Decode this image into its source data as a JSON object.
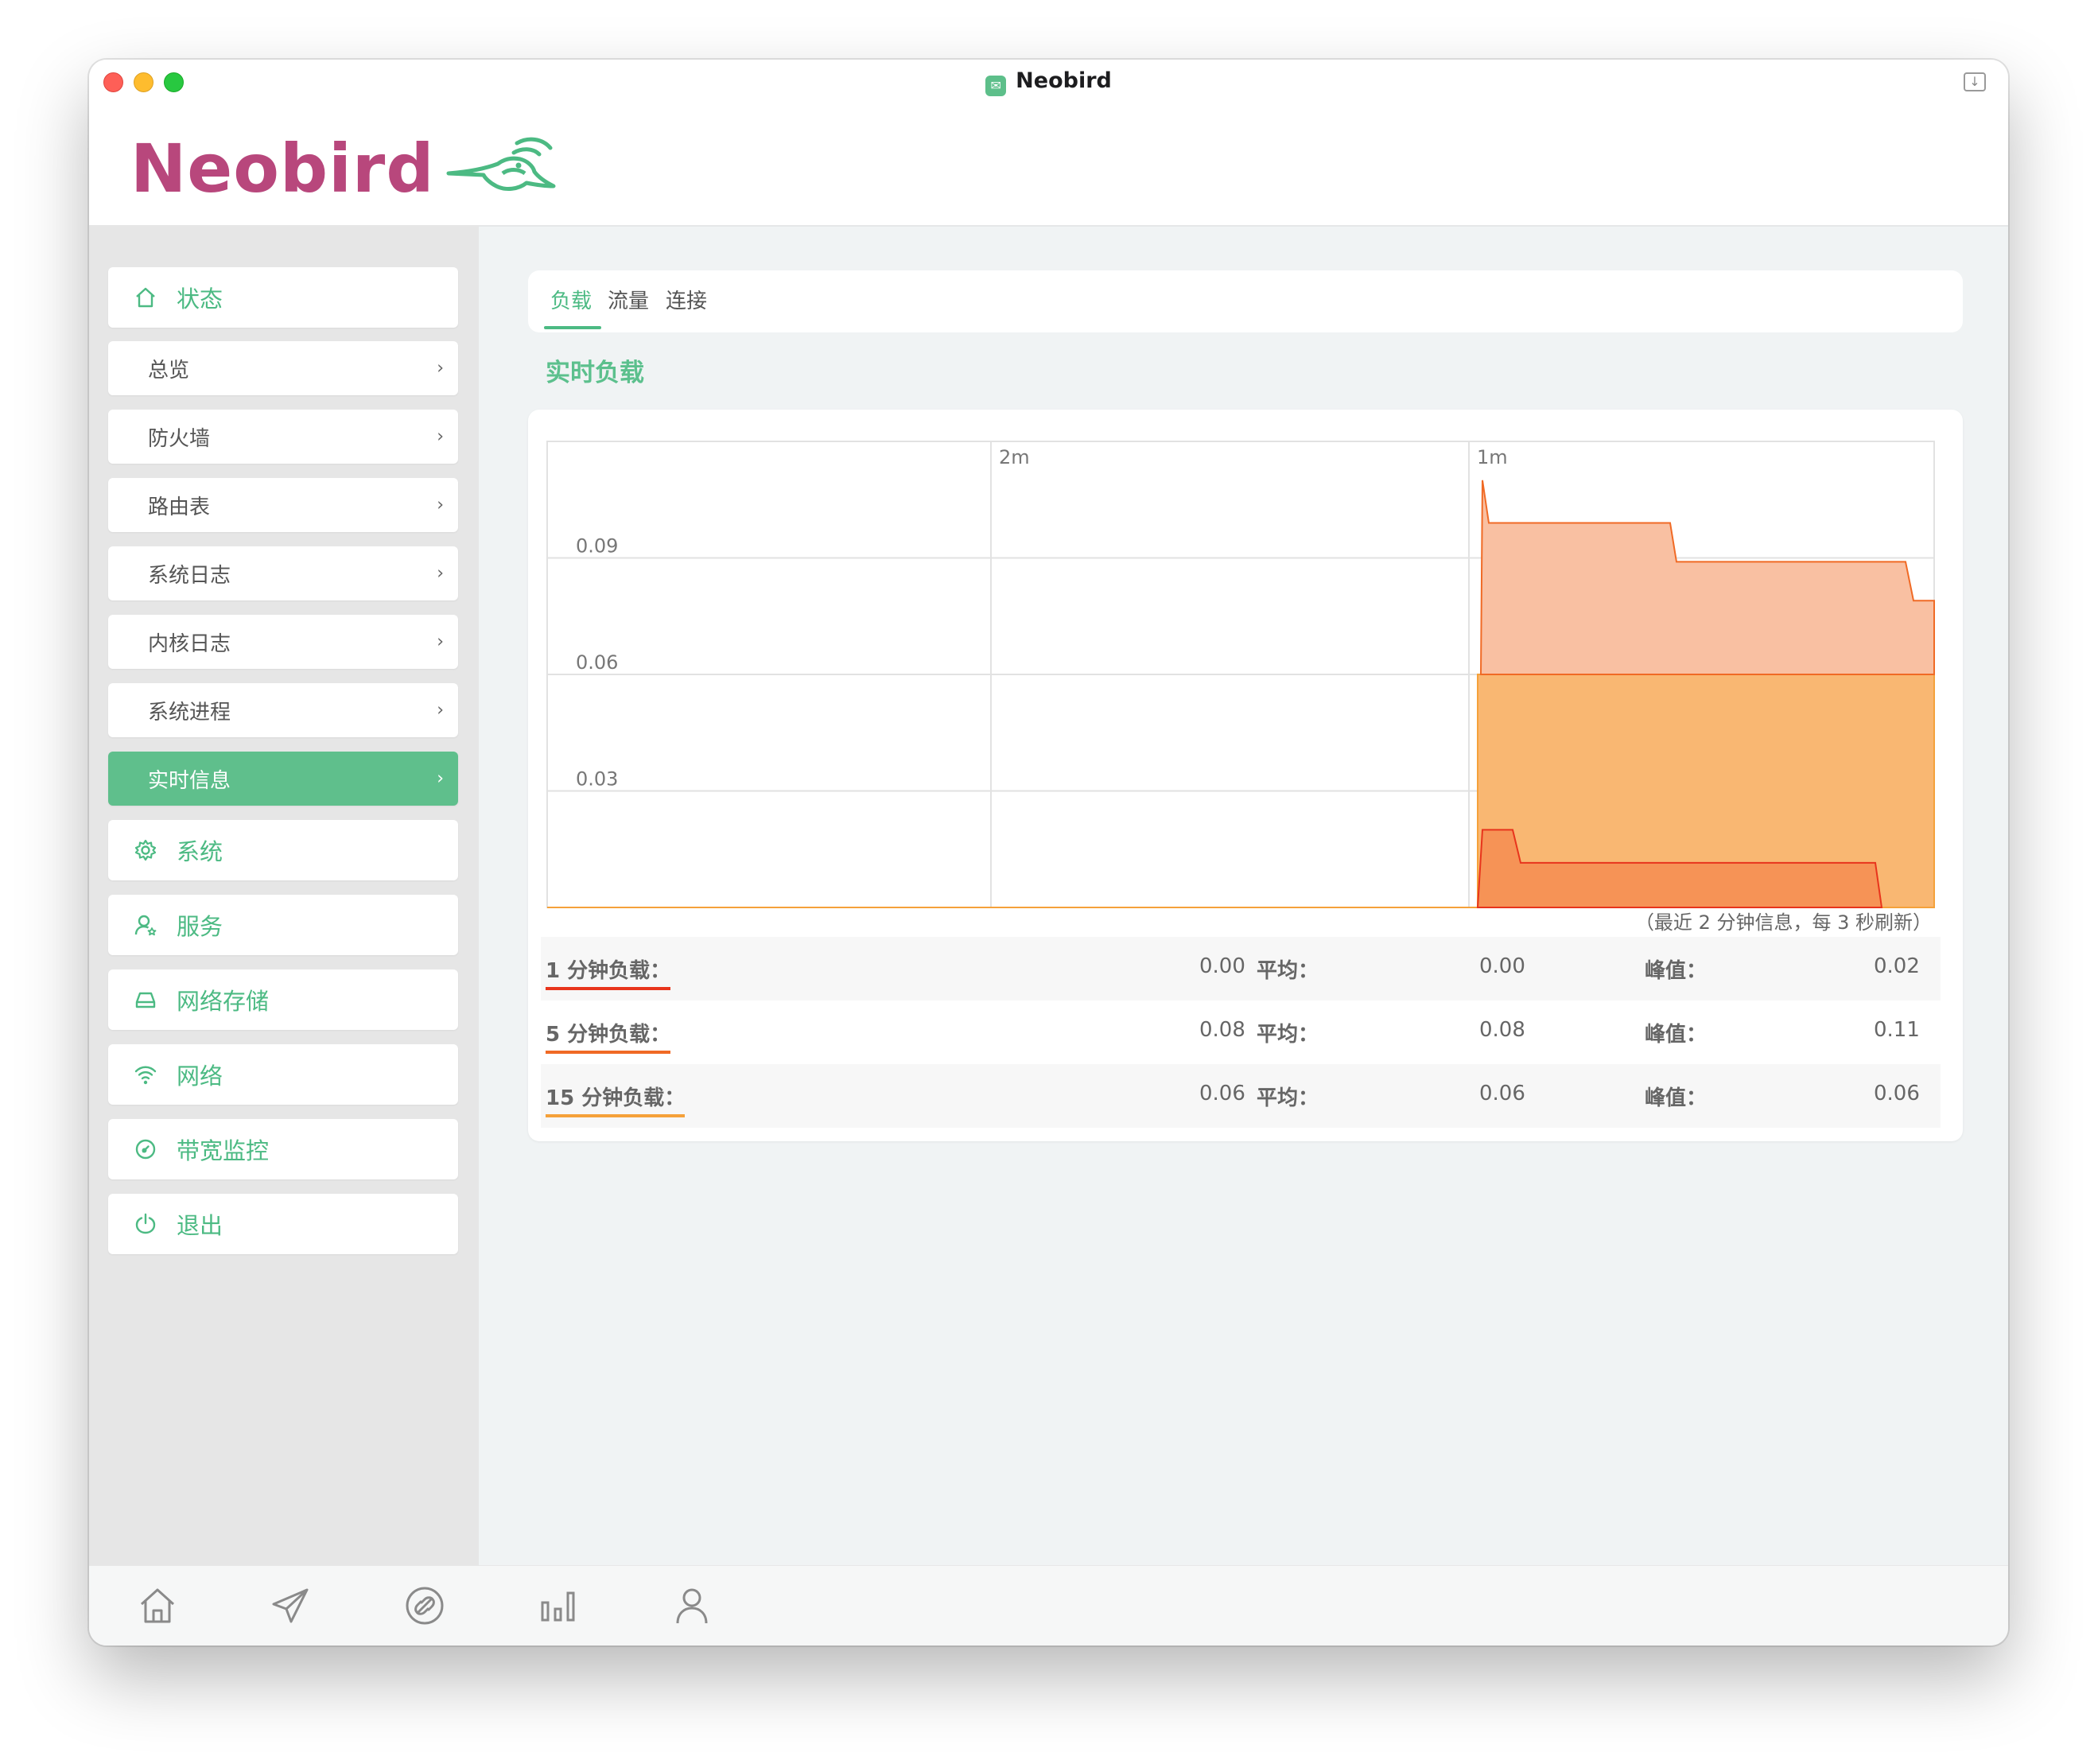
{
  "window": {
    "title": "Neobird",
    "app_icon": "neobird-app-icon"
  },
  "logo": {
    "text": "Neobird",
    "color": "#b8477c",
    "bird_color": "#4cba83"
  },
  "sidebar": {
    "accent": "#5fbf8c",
    "items": [
      {
        "label": "状态",
        "icon": "home-icon",
        "type": "main"
      },
      {
        "label": "总览",
        "type": "sub"
      },
      {
        "label": "防火墙",
        "type": "sub"
      },
      {
        "label": "路由表",
        "type": "sub"
      },
      {
        "label": "系统日志",
        "type": "sub"
      },
      {
        "label": "内核日志",
        "type": "sub"
      },
      {
        "label": "系统进程",
        "type": "sub"
      },
      {
        "label": "实时信息",
        "type": "sub",
        "active": true
      },
      {
        "label": "系统",
        "icon": "gear-icon",
        "type": "main"
      },
      {
        "label": "服务",
        "icon": "user-star-icon",
        "type": "main"
      },
      {
        "label": "网络存储",
        "icon": "drive-icon",
        "type": "main"
      },
      {
        "label": "网络",
        "icon": "wifi-icon",
        "type": "main"
      },
      {
        "label": "带宽监控",
        "icon": "gauge-icon",
        "type": "main"
      },
      {
        "label": "退出",
        "icon": "power-icon",
        "type": "main"
      }
    ]
  },
  "tabs": [
    {
      "label": "负载",
      "active": true
    },
    {
      "label": "流量",
      "active": false
    },
    {
      "label": "连接",
      "active": false
    }
  ],
  "section_title": "实时负载",
  "chart_data": {
    "type": "area",
    "x_labels": [
      "2m",
      "1m"
    ],
    "y_ticks": [
      "0.09",
      "0.06",
      "0.03"
    ],
    "ylim": [
      0,
      0.12
    ],
    "grid": true,
    "note": "（最近 2 分钟信息，每 3 秒刷新）",
    "series": [
      {
        "name": "15 分钟负载",
        "color": "#f5a13a",
        "values": [
          0.06,
          0.06,
          0.06,
          0.06
        ]
      },
      {
        "name": "5 分钟负载",
        "color": "#f06a25",
        "values": [
          0.11,
          0.099,
          0.089,
          0.079
        ]
      },
      {
        "name": "1 分钟负载",
        "color": "#e8341c",
        "values": [
          0.02,
          0.02,
          0.01,
          0.01,
          0.0
        ]
      }
    ]
  },
  "stats": [
    {
      "label": "1 分钟负载：",
      "current": "0.00",
      "avg_label": "平均：",
      "avg": "0.00",
      "peak_label": "峰值：",
      "peak": "0.02",
      "color": "#e8341c"
    },
    {
      "label": "5 分钟负载：",
      "current": "0.08",
      "avg_label": "平均：",
      "avg": "0.08",
      "peak_label": "峰值：",
      "peak": "0.11",
      "color": "#f06a25"
    },
    {
      "label": "15 分钟负载：",
      "current": "0.06",
      "avg_label": "平均：",
      "avg": "0.06",
      "peak_label": "峰值：",
      "peak": "0.06",
      "color": "#f5a13a"
    }
  ],
  "bottom_bar": [
    "home-icon",
    "send-icon",
    "link-icon",
    "bar-chart-icon",
    "user-icon"
  ]
}
